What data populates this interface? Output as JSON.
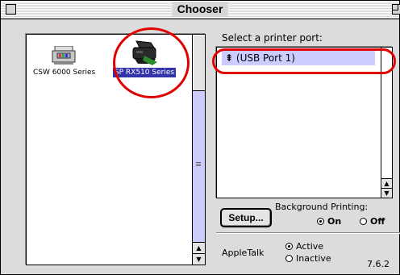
{
  "window": {
    "title": "Chooser"
  },
  "devices": [
    {
      "label": "CSW 6000 Series",
      "icon": "printer-icon",
      "selected": false
    },
    {
      "label": "SP RX510 Series",
      "icon": "multifunction-printer-icon",
      "selected": true
    }
  ],
  "port_panel": {
    "heading": "Select a printer port:",
    "ports": [
      {
        "label": "(USB Port 1)",
        "icon": "usb-icon",
        "selected": true
      }
    ]
  },
  "setup_button": {
    "label": "Setup..."
  },
  "background_printing": {
    "label": "Background Printing:",
    "options": [
      {
        "label": "On",
        "selected": true
      },
      {
        "label": "Off",
        "selected": false
      }
    ]
  },
  "appletalk": {
    "label": "AppleTalk",
    "options": [
      {
        "label": "Active",
        "selected": true
      },
      {
        "label": "Inactive",
        "selected": false
      }
    ]
  },
  "version": "7.6.2",
  "colors": {
    "selection": "#3333aa",
    "port_highlight": "#ccccff",
    "scroll_track": "#ccccff",
    "annotation": "#e00000"
  }
}
